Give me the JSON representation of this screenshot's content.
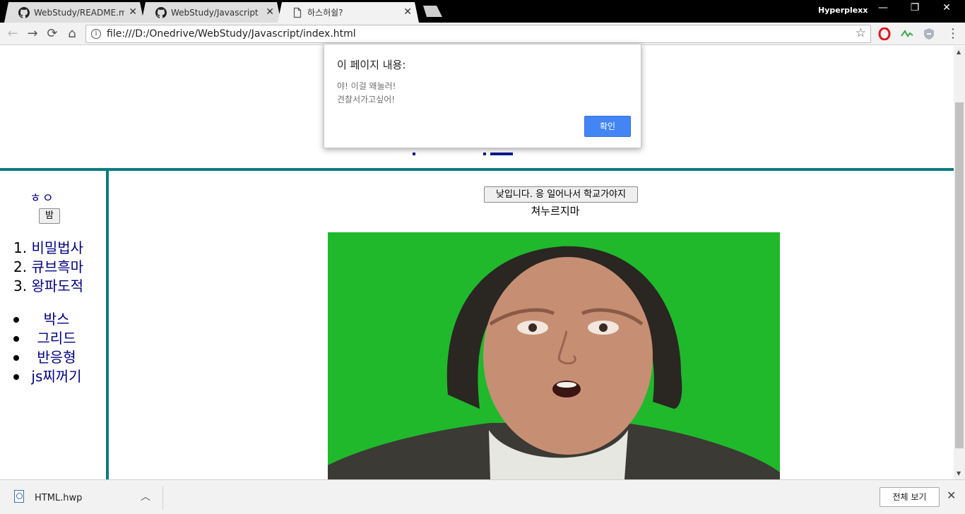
{
  "browser": {
    "tabs": [
      {
        "title": "WebStudy/README.md",
        "icon": "github-icon",
        "active": false
      },
      {
        "title": "WebStudy/Javascript at",
        "icon": "github-icon",
        "active": false
      },
      {
        "title": "하스허쉴?",
        "icon": "page-icon",
        "active": true
      }
    ],
    "profile_name": "Hyperplexx",
    "address_url": "file:///D:/Onedrive/WebStudy/Javascript/index.html",
    "accent_color": "#0b7b7d"
  },
  "alert": {
    "title": "이 페이지 내용:",
    "lines": [
      "야! 이걸 왜눌러!",
      "견찰서가고싶어!"
    ],
    "ok_label": "확인"
  },
  "sidebar": {
    "letters": "ㅎㅇ",
    "night_button": "밤",
    "ordered_items": [
      "비밀법사",
      "큐브흑마",
      "왕파도적"
    ],
    "ordered_numbers": [
      "1.",
      "2.",
      "3."
    ],
    "bullet_items": [
      "박스",
      "그리드",
      "반응형",
      "js찌꺼기"
    ]
  },
  "content": {
    "wake_button": "낮입니다. 응 일어나서 학교가야지",
    "caption": "쳐누르지마"
  },
  "downloads": {
    "file_name": "HTML.hwp",
    "show_all_label": "전체 보기"
  }
}
